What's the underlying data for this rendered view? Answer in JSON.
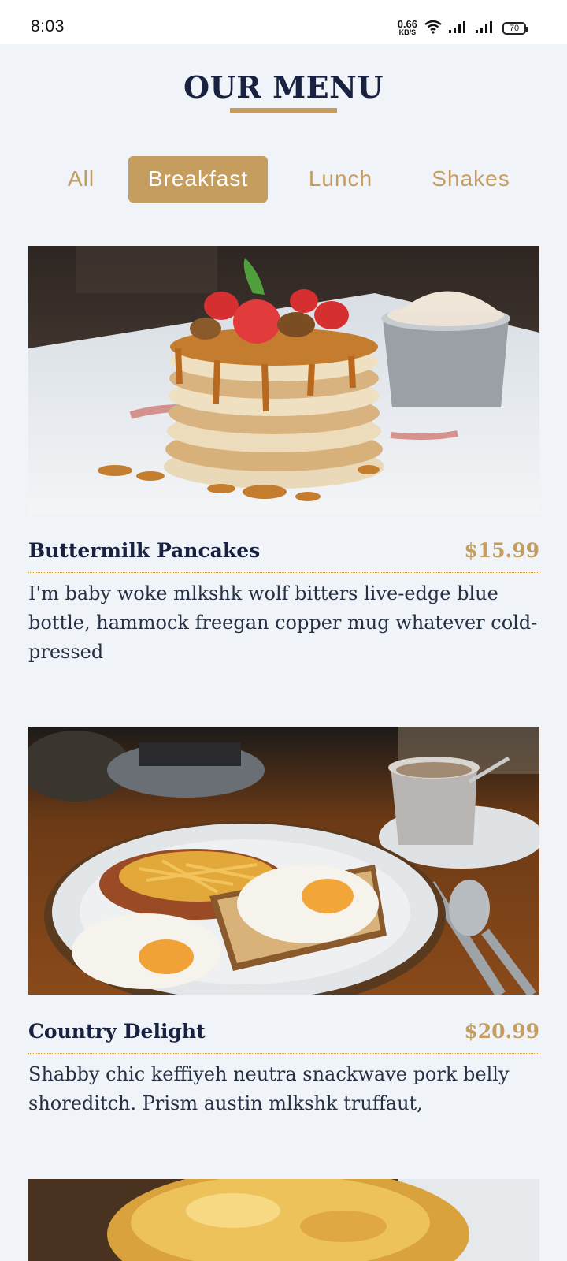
{
  "status_bar": {
    "time": "8:03",
    "net_speed": "0.66",
    "net_unit": "KB/S",
    "battery": "70",
    "icons": [
      "wifi-icon",
      "signal-icon",
      "signal-icon",
      "battery-icon"
    ]
  },
  "page": {
    "title": "OUR MENU"
  },
  "tabs": [
    {
      "label": "All",
      "active": false
    },
    {
      "label": "Breakfast",
      "active": true
    },
    {
      "label": "Lunch",
      "active": false
    },
    {
      "label": "Shakes",
      "active": false
    }
  ],
  "menu_items": [
    {
      "name": "Buttermilk Pancakes",
      "price": "$15.99",
      "description": "I'm baby woke mlkshk wolf bitters live-edge blue bottle, hammock freegan copper mug whatever cold-pressed"
    },
    {
      "name": "Country Delight",
      "price": "$20.99",
      "description": "Shabby chic keffiyeh neutra snackwave pork belly shoreditch. Prism austin mlkshk truffaut,"
    }
  ],
  "colors": {
    "accent": "#c59d5f",
    "heading": "#18213f",
    "background": "#f0f3f7"
  }
}
